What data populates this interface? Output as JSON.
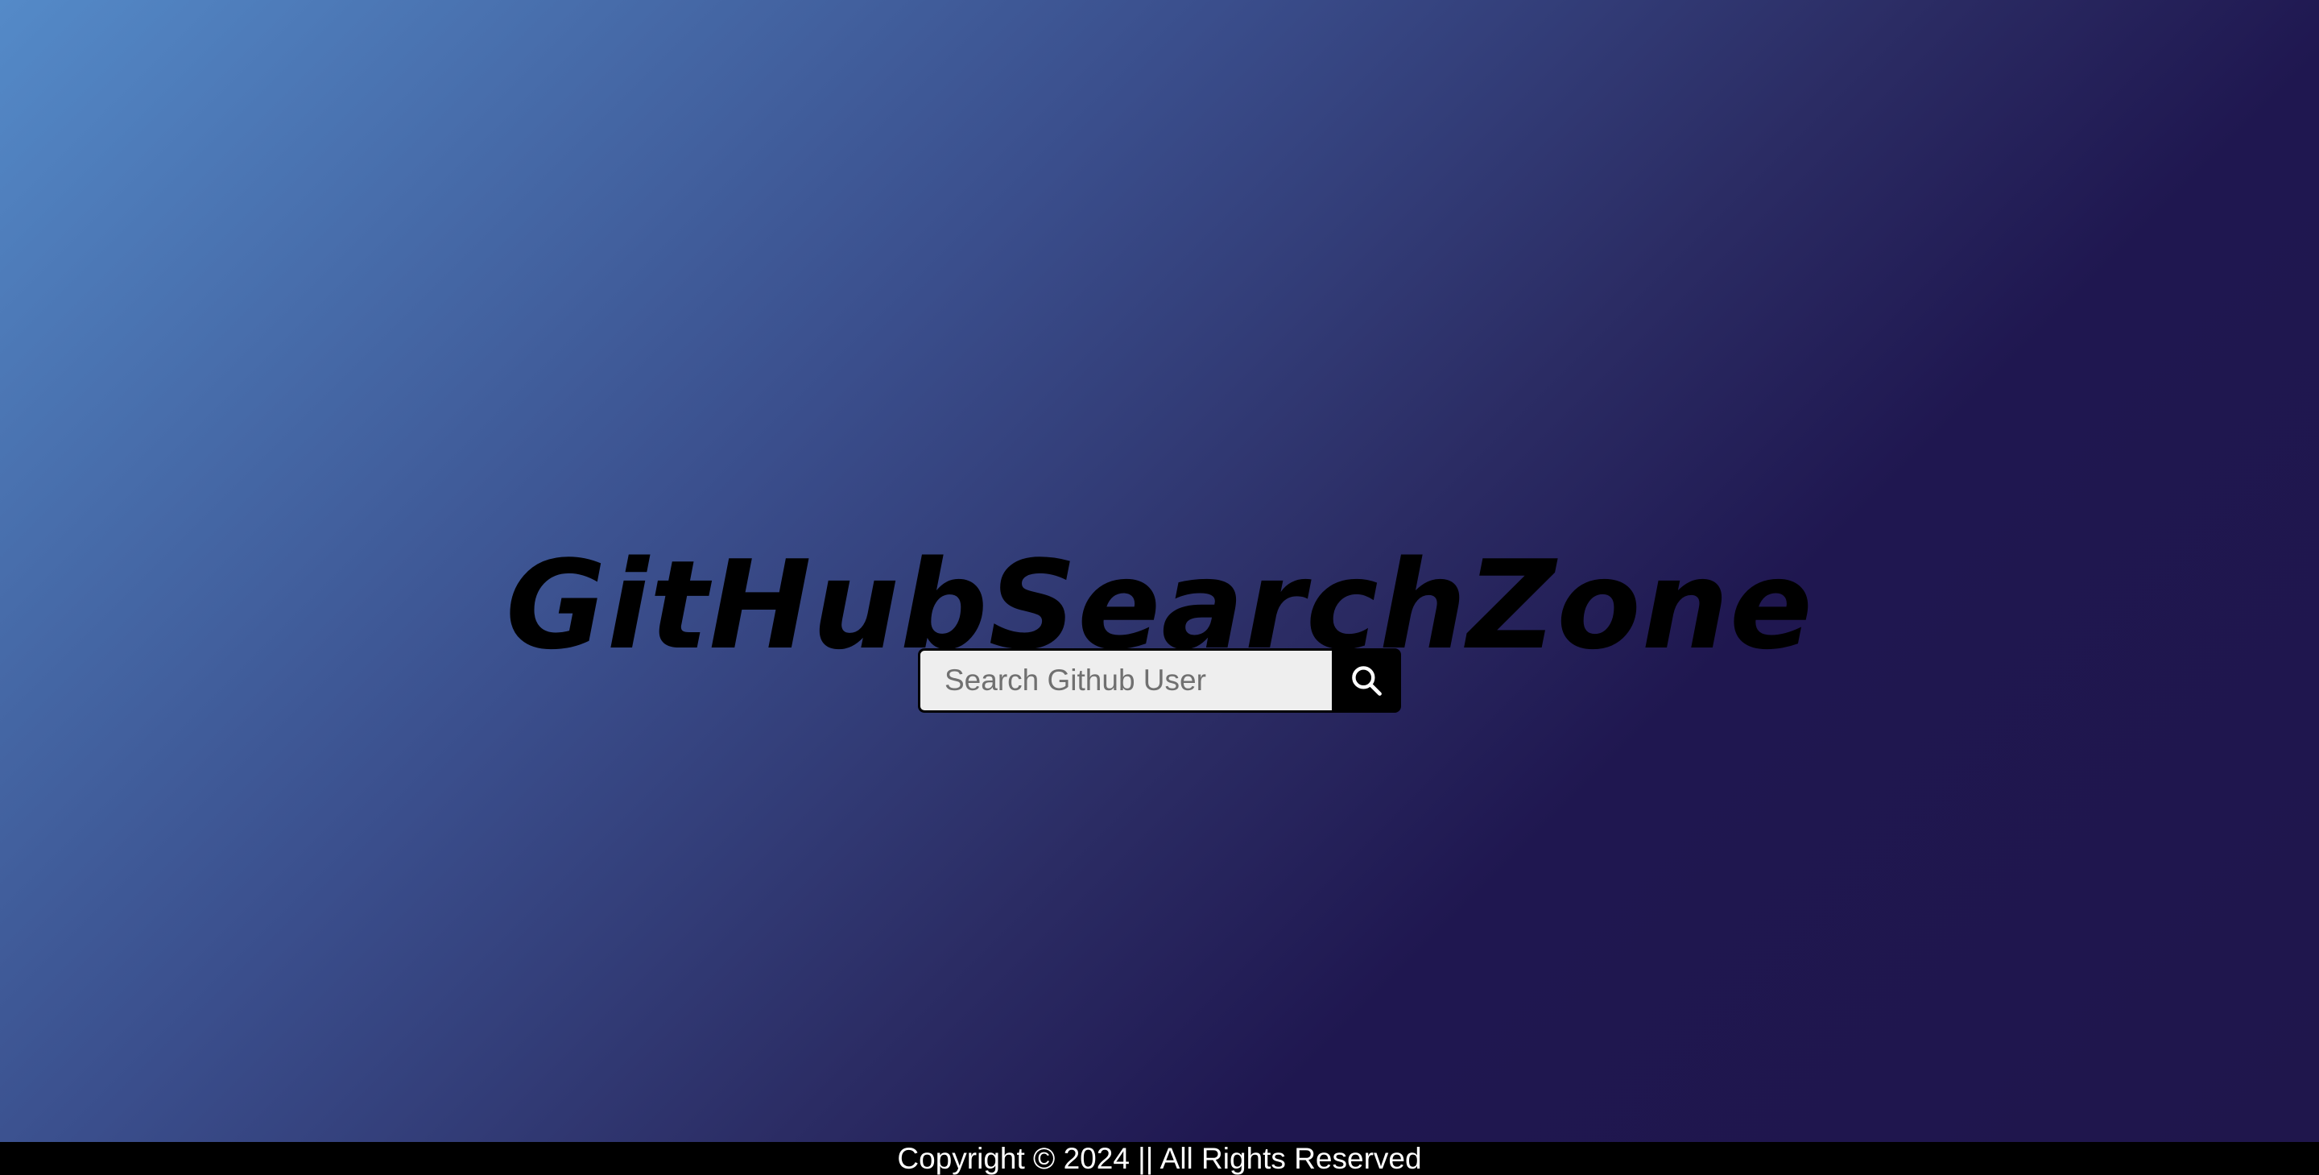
{
  "app": {
    "title": "GitHubSearchZone"
  },
  "search": {
    "placeholder": "Search Github User",
    "value": "",
    "button_icon": "search-icon"
  },
  "footer": {
    "text": "Copyright © 2024 || All Rights Reserved"
  },
  "colors": {
    "gradient_start": "#548ac8",
    "gradient_end": "#1f164c",
    "title": "#000000",
    "input_background": "#eeeeee",
    "button_background": "#000000",
    "footer_background": "#000000",
    "footer_text": "#ffffff"
  }
}
